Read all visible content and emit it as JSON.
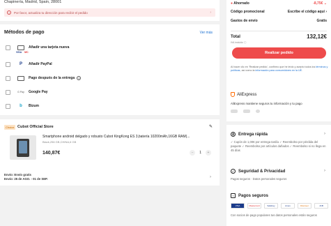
{
  "address": "Chapinería, Madrid, Spain, 28001",
  "warning": "Por favor, actualiza tu dirección para recibir el pedido",
  "payment": {
    "title": "Métodos de pago",
    "more": "Ver más",
    "methods": [
      {
        "label": "Añadir una tarjeta nueva",
        "icon": "card-icon"
      },
      {
        "label": "Añadir PayPal",
        "icon": "paypal-icon"
      },
      {
        "label": "Pago después de la entrega",
        "icon": "clock-icon"
      },
      {
        "label": "Google Pay",
        "icon": "gpay-icon"
      },
      {
        "label": "Bizum",
        "icon": "bizum-icon"
      }
    ],
    "card_logos": [
      "VISA",
      "MC"
    ]
  },
  "store": {
    "choice_badge": "Choice",
    "name": "Cubot Official Store",
    "product_title": "Smartphone android delgado y robusto Cubot KingKong ES 3,batería 10200mAh,16GB RAM(...",
    "variant": "Black,256 GB,CHINA,6 GB",
    "price": "140,87€",
    "quantity": "1",
    "shipping_line1": "Envío: Envío gratis",
    "shipping_line2": "Envío: 25 de AGO. - 01 de SEP."
  },
  "summary": {
    "saved_label": "Ahorrado",
    "saved_value": "-8,75€",
    "promo_label": "Código promocional",
    "promo_value": "Escribe el código aquí",
    "shipping_label": "Gastos de envío",
    "shipping_value": "Gratis",
    "total_label": "Total",
    "total_value": "132,12€",
    "iva_note": "IVA incluido",
    "order_button": "Realizar pedido",
    "legal_pre": "Al hacer clic en 'Realizar pedido', confirmo que he leído y acepto todos los ",
    "legal_link1": "términos y políticas",
    "legal_mid": ", así como la ",
    "legal_link2": "información para consumidores en la UE",
    "legal_end": "."
  },
  "aliexpress": {
    "brand": "AliExpress",
    "text": "AliExpress mantiene seguros tu información y tu pago"
  },
  "features": {
    "fast_title": "Entrega rápida",
    "fast_text": "✓ Cupón de 1,00€ por entrega tardía ✓ Reembolso por pérdida del paquete ✓ Reembolso por artículos dañados ✓ Reembolso si no llega en 45 días",
    "security_title": "Seguridad & Privacidad",
    "security_text": "Pagos seguros · Datos personales seguros",
    "payments_title": "Pagos seguros",
    "payments_text": "Con socios de pago populares tus datos personales están seguros",
    "payment_logos": [
      "VISA",
      "Mastercard",
      "SafeKey",
      "Amex",
      "Discover",
      "JCB"
    ]
  }
}
